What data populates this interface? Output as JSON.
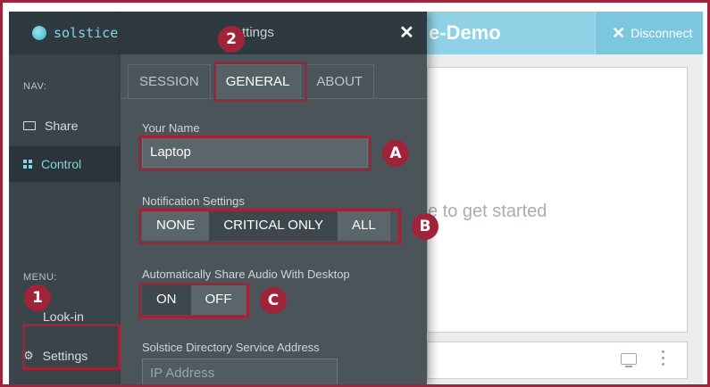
{
  "app": {
    "brand": "solstice",
    "session_title": "e-Demo",
    "disconnect_label": "Disconnect"
  },
  "sidebar": {
    "nav_label": "NAV:",
    "items": [
      {
        "label": "Share",
        "icon": "monitor-icon"
      },
      {
        "label": "Control",
        "icon": "grid-icon"
      }
    ],
    "menu_label": "MENU:",
    "menu_items": [
      {
        "label": "Look-in"
      },
      {
        "label": "Settings",
        "icon": "gear-icon"
      }
    ]
  },
  "main": {
    "hint_text": "e to get started"
  },
  "settings_panel": {
    "title": "ttings",
    "tabs": [
      {
        "label": "SESSION",
        "active": false
      },
      {
        "label": "GENERAL",
        "active": true
      },
      {
        "label": "ABOUT",
        "active": false
      }
    ],
    "your_name_label": "Your Name",
    "your_name_value": "Laptop",
    "notification_label": "Notification Settings",
    "notification_options": [
      "NONE",
      "CRITICAL ONLY",
      "ALL"
    ],
    "notification_selected": "CRITICAL ONLY",
    "audio_label": "Automatically Share Audio With Desktop",
    "audio_options": [
      "ON",
      "OFF"
    ],
    "audio_selected": "ON",
    "directory_label": "Solstice Directory Service Address",
    "directory_placeholder": "IP Address"
  },
  "annotations": {
    "step1": "1",
    "step2": "2",
    "a": "A",
    "b": "B",
    "c": "C"
  },
  "colors": {
    "annotation": "#a0233a",
    "accent": "#7fd6e3",
    "session_header": "#8fd2e6"
  }
}
